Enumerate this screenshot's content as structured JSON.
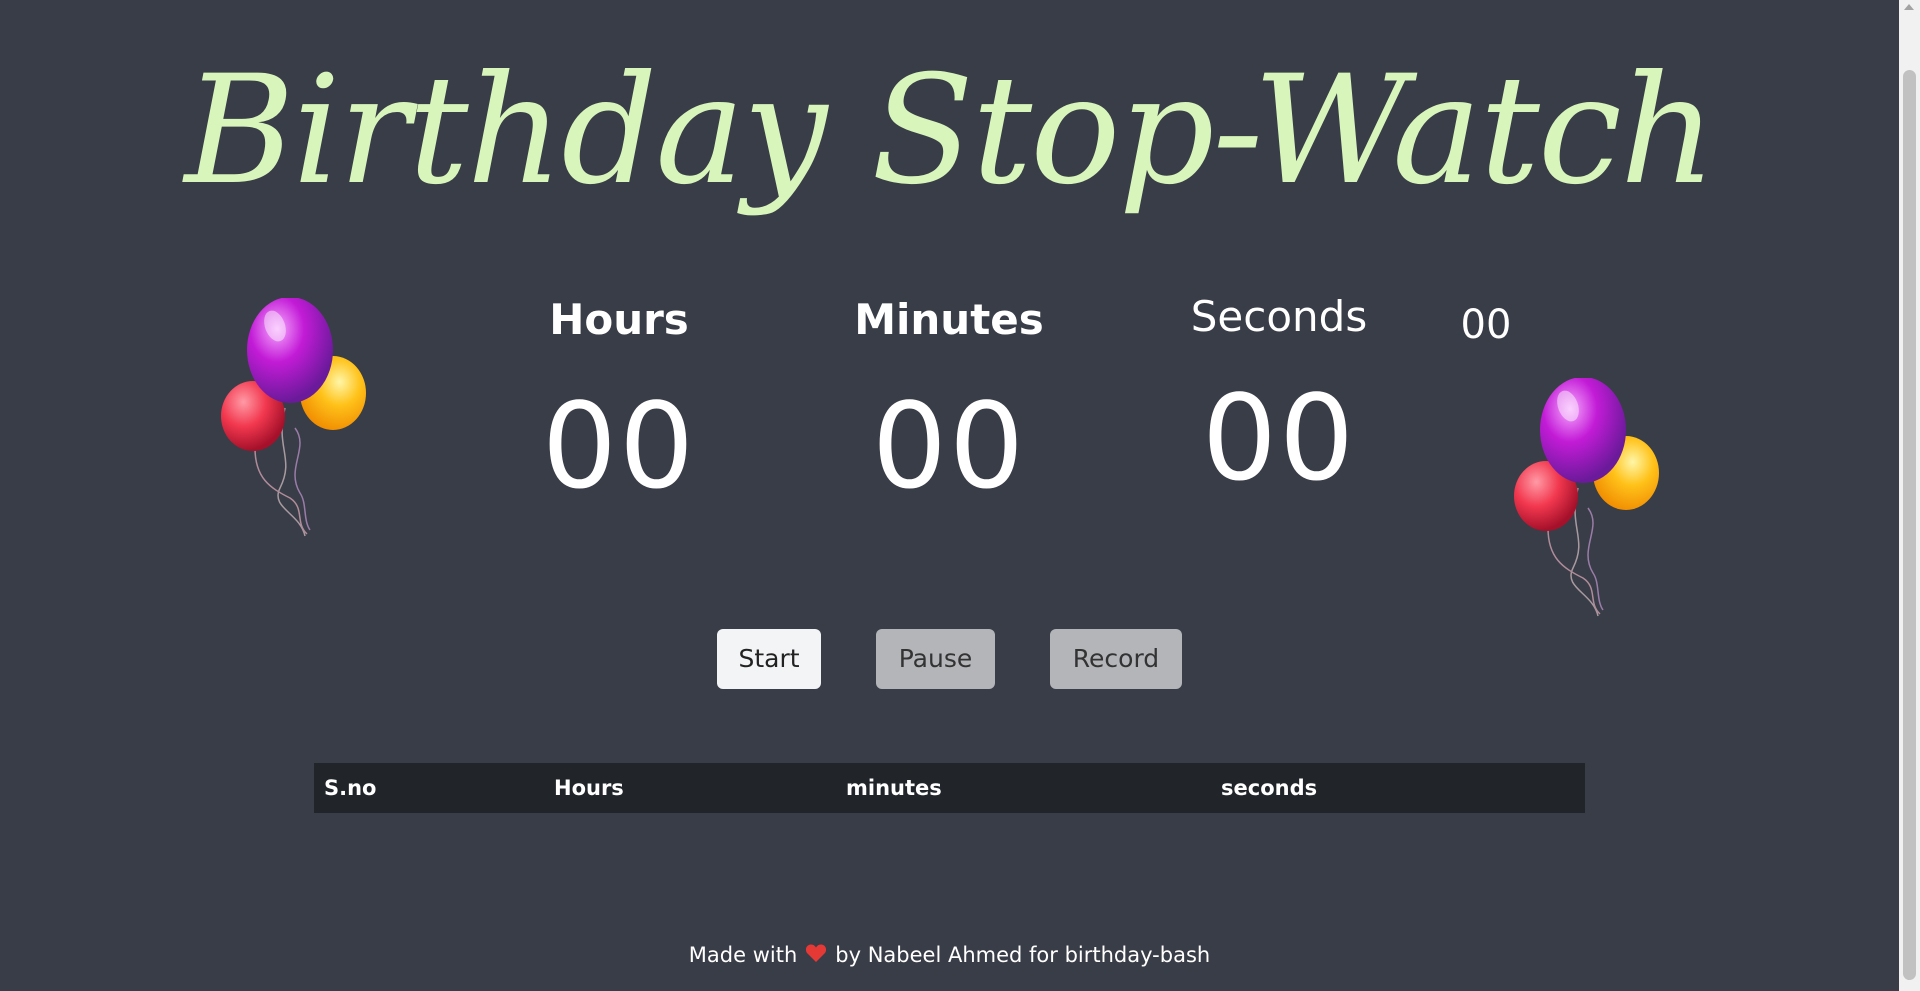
{
  "title": "Birthday Stop-Watch",
  "timer": {
    "hours": {
      "label": "Hours",
      "value": "00"
    },
    "minutes": {
      "label": "Minutes",
      "value": "00"
    },
    "seconds": {
      "label": "Seconds",
      "value": "00"
    },
    "milliseconds": {
      "value": "00"
    }
  },
  "controls": {
    "start_label": "Start",
    "pause_label": "Pause",
    "record_label": "Record"
  },
  "records_table": {
    "columns": [
      "S.no",
      "Hours",
      "minutes",
      "seconds"
    ],
    "rows": []
  },
  "footer": {
    "made_with": "Made with",
    "credit": "by Nabeel Ahmed for birthday-bash"
  },
  "colors": {
    "background": "#393d47",
    "title": "#d8f5bb",
    "table_header": "#212529",
    "heart": "#e53935"
  },
  "icons": {
    "balloons_left": "balloons-icon",
    "balloons_right": "balloons-icon",
    "heart": "heart-icon"
  }
}
